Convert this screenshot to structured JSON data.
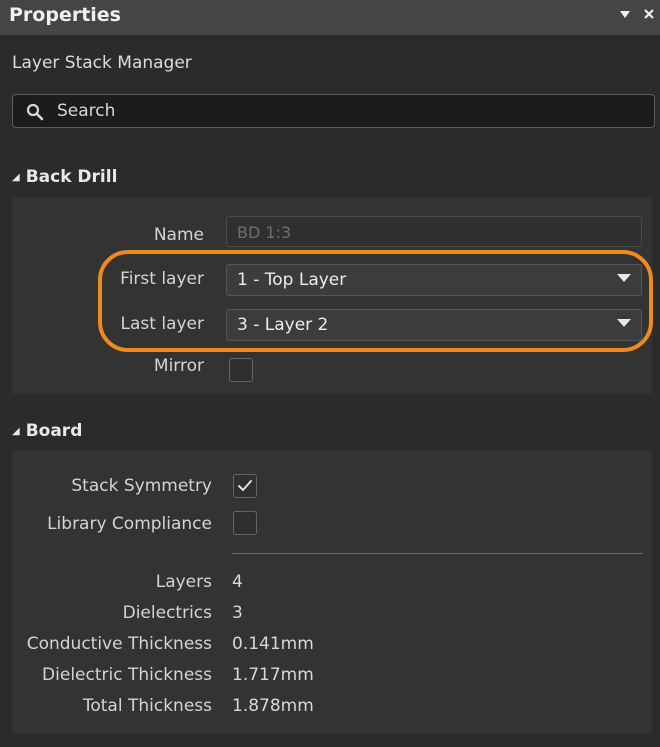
{
  "header": {
    "title": "Properties",
    "menu_icon": "dropdown-arrow",
    "close_icon": "close-x"
  },
  "subtitle": "Layer Stack Manager",
  "search": {
    "placeholder": "Search",
    "icon": "search-icon"
  },
  "back_drill": {
    "header": "Back Drill",
    "name_label": "Name",
    "name_value": "BD 1:3",
    "first_layer_label": "First layer",
    "first_layer_value": "1 - Top Layer",
    "last_layer_label": "Last layer",
    "last_layer_value": "3 - Layer 2",
    "mirror_label": "Mirror",
    "mirror_checked": false,
    "highlight_color": "#f08a1c"
  },
  "board": {
    "header": "Board",
    "stack_symmetry_label": "Stack Symmetry",
    "stack_symmetry_checked": true,
    "library_compliance_label": "Library Compliance",
    "library_compliance_checked": false,
    "stats": {
      "layers_label": "Layers",
      "layers_value": "4",
      "dielectrics_label": "Dielectrics",
      "dielectrics_value": "3",
      "conductive_label": "Conductive Thickness",
      "conductive_value": "0.141mm",
      "dielectric_thickness_label": "Dielectric Thickness",
      "dielectric_thickness_value": "1.717mm",
      "total_label": "Total Thickness",
      "total_value": "1.878mm"
    }
  }
}
